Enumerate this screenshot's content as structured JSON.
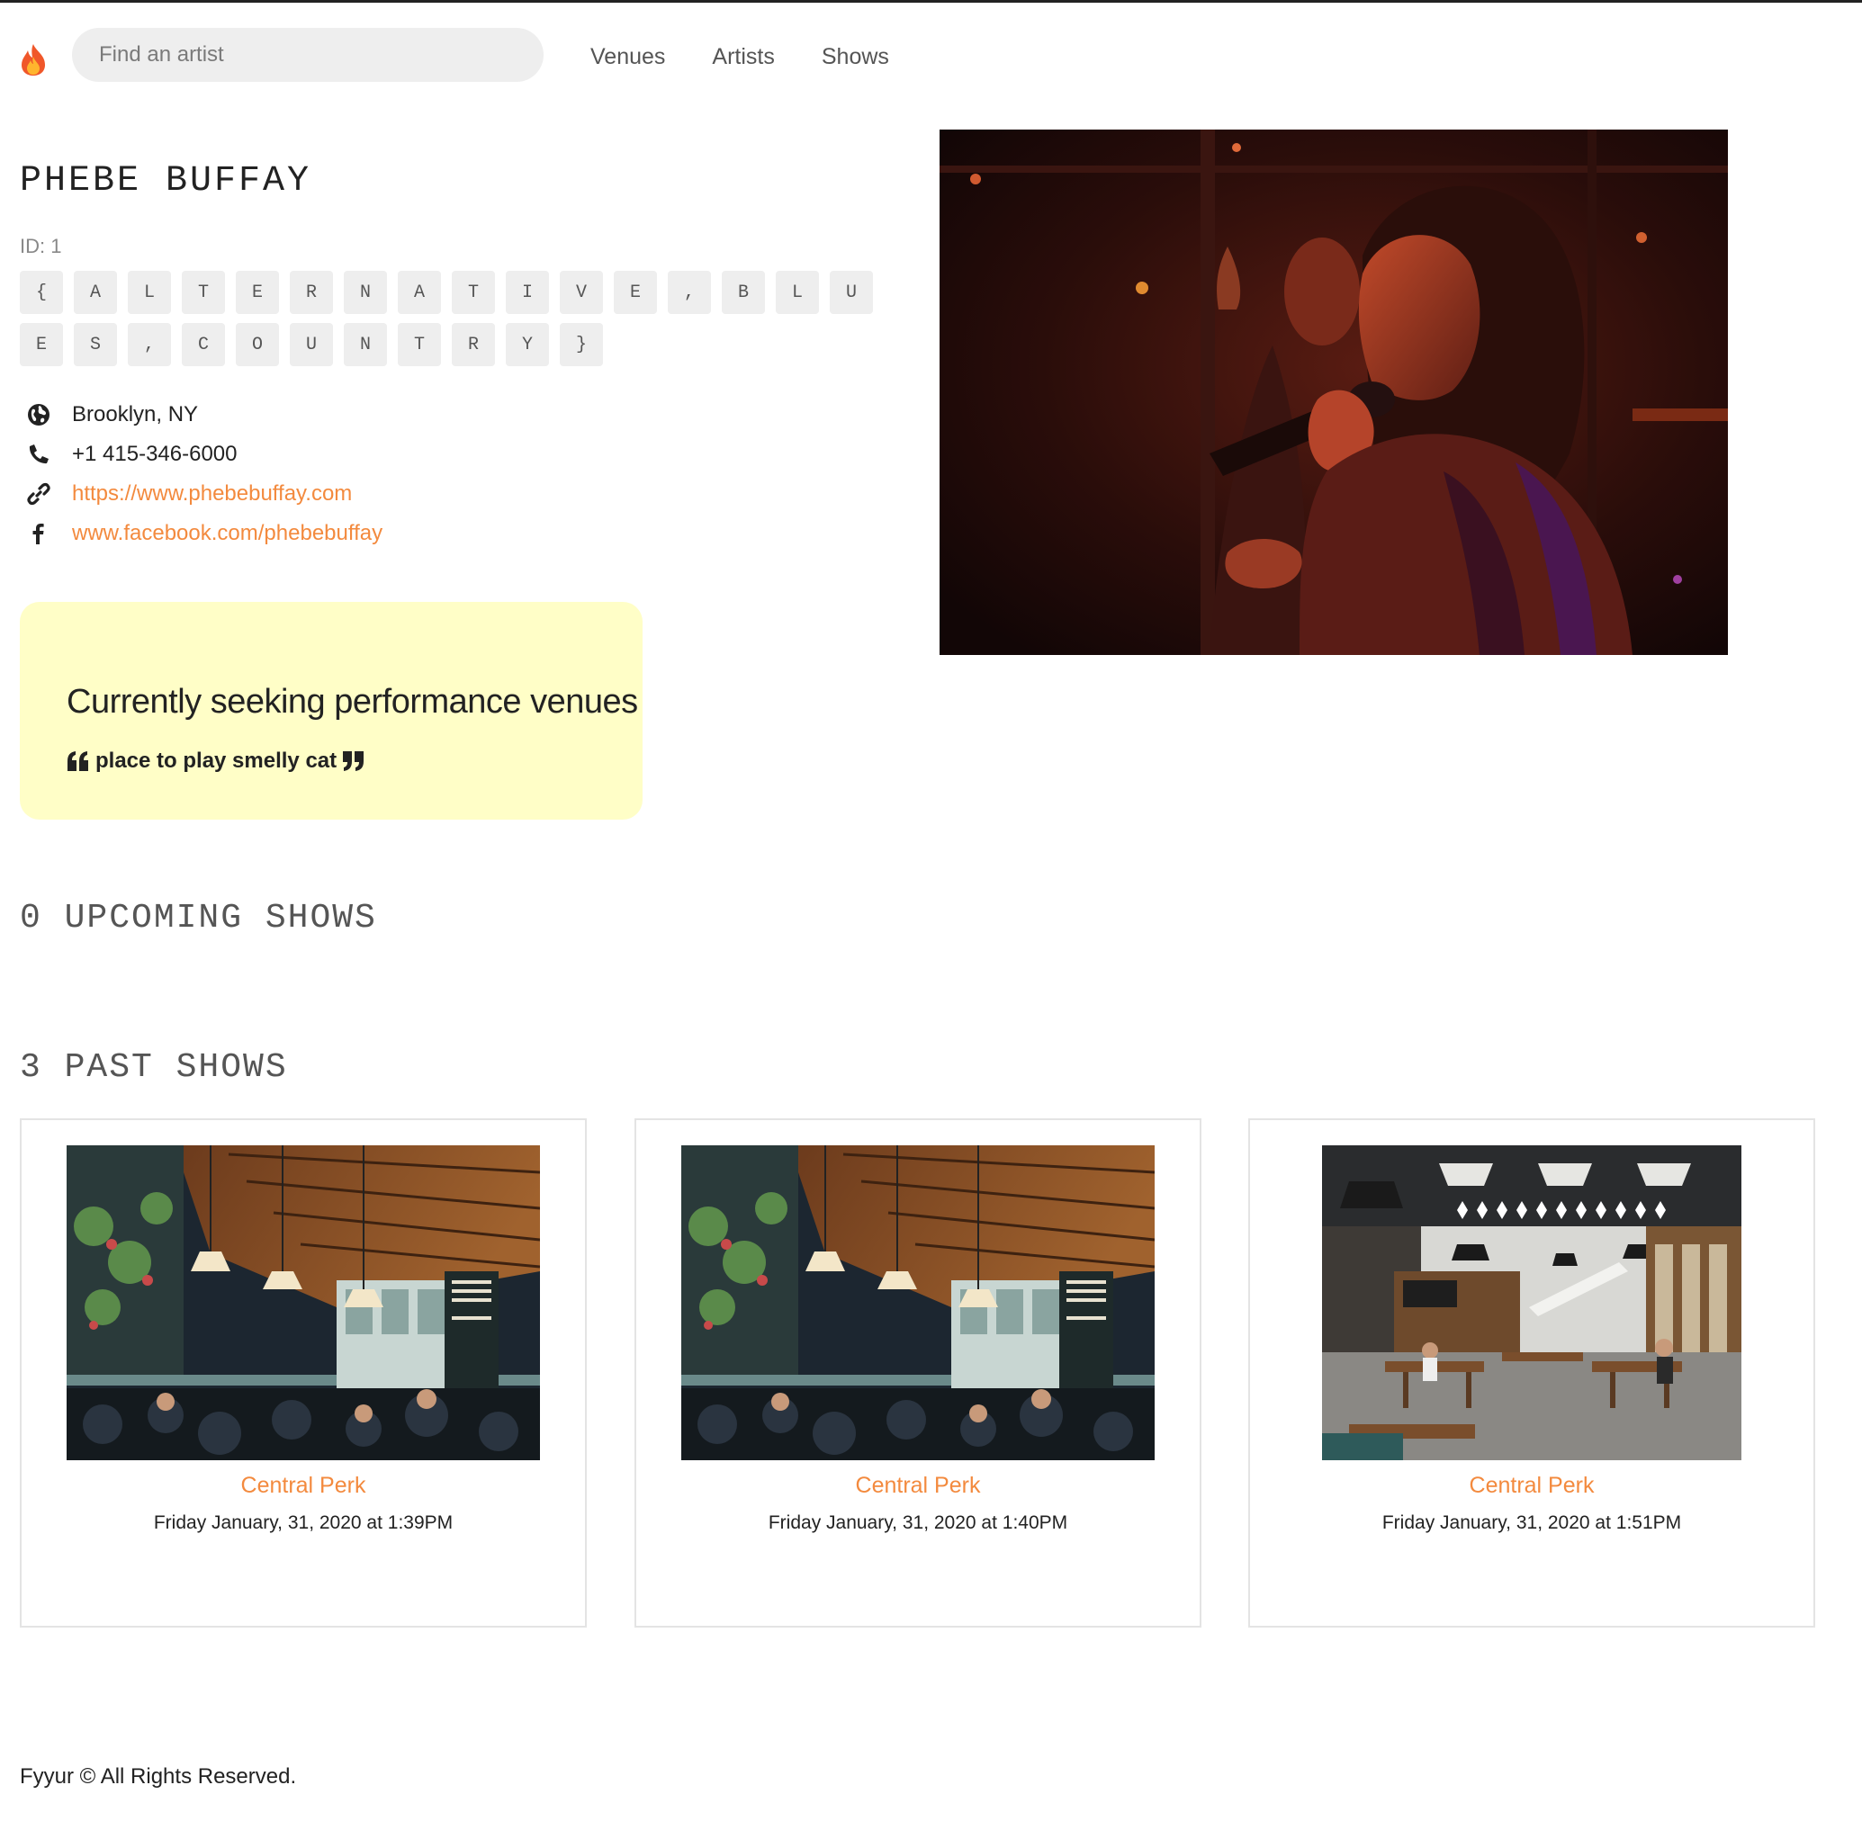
{
  "nav": {
    "search_placeholder": "Find an artist",
    "links": [
      "Venues",
      "Artists",
      "Shows"
    ]
  },
  "artist": {
    "name": "PHEBE BUFFAY",
    "id_label": "ID: 1",
    "genre_chars": [
      "{",
      "A",
      "L",
      "T",
      "E",
      "R",
      "N",
      "A",
      "T",
      "I",
      "V",
      "E",
      ",",
      "B",
      "L",
      "U",
      "E",
      "S",
      ",",
      "C",
      "O",
      "U",
      "N",
      "T",
      "R",
      "Y",
      "}"
    ],
    "city_state": "Brooklyn, NY",
    "phone": "+1 415-346-6000",
    "website": "https://www.phebebuffay.com",
    "facebook": "www.facebook.com/phebebuffay"
  },
  "seeking": {
    "title": "Currently seeking performance venues",
    "description": "place to play smelly cat"
  },
  "upcoming": {
    "title": "0 UPCOMING SHOWS"
  },
  "past": {
    "title": "3 PAST SHOWS",
    "shows": [
      {
        "venue": "Central Perk",
        "time": "Friday January, 31, 2020 at 1:39PM"
      },
      {
        "venue": "Central Perk",
        "time": "Friday January, 31, 2020 at 1:40PM"
      },
      {
        "venue": "Central Perk",
        "time": "Friday January, 31, 2020 at 1:51PM"
      }
    ]
  },
  "footer": {
    "text": "Fyyur © All Rights Reserved."
  },
  "colors": {
    "accent": "#f38a3e",
    "seeking_bg": "#fffec7",
    "chip_bg": "#eeeeee"
  }
}
